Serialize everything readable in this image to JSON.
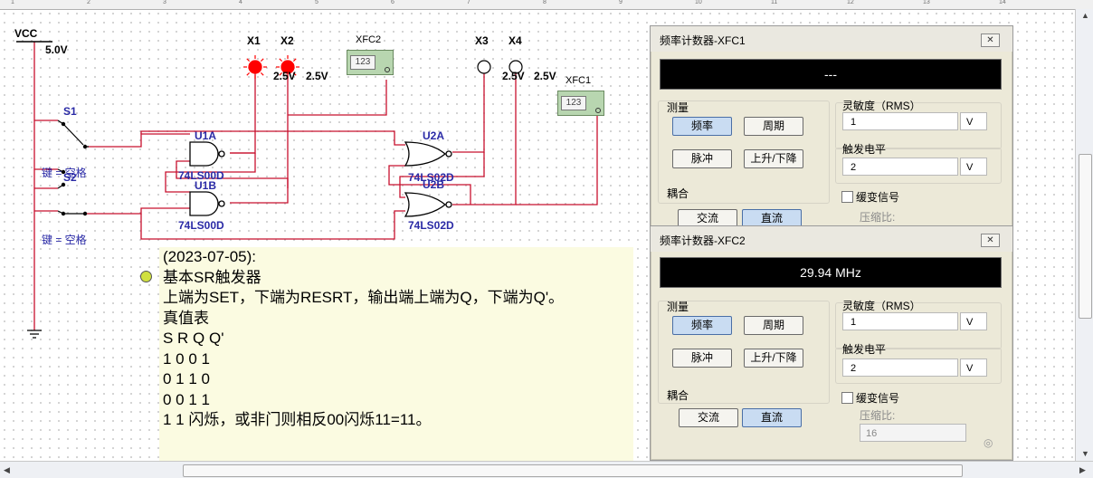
{
  "ruler_ticks": [
    "1",
    "2",
    "3",
    "4",
    "5",
    "6",
    "7",
    "8",
    "9",
    "10",
    "11",
    "12",
    "13",
    "14"
  ],
  "schematic": {
    "vcc_label": "VCC",
    "vcc_voltage": "5.0V",
    "switch1": {
      "name": "S1",
      "key": "键 = 空格"
    },
    "switch2": {
      "name": "S2",
      "key": "键 = 空格"
    },
    "gate_u1a": {
      "name": "U1A",
      "part": "74LS00D"
    },
    "gate_u1b": {
      "name": "U1B",
      "part": "74LS00D"
    },
    "gate_u2a": {
      "name": "U2A",
      "part": "74LS02D"
    },
    "gate_u2b": {
      "name": "U2B",
      "part": "74LS02D"
    },
    "probes": [
      {
        "name": "X1",
        "voltage": "2.5V",
        "lit": true
      },
      {
        "name": "X2",
        "voltage": "2.5V",
        "lit": true
      },
      {
        "name": "X3",
        "voltage": "2.5V",
        "lit": false
      },
      {
        "name": "X4",
        "voltage": "2.5V",
        "lit": false
      }
    ],
    "xfc2_label": "XFC2",
    "xfc1_label": "XFC1",
    "instrument_display": "123",
    "wire_color": "#c8102e",
    "probe_lit_color": "#ff0000"
  },
  "note": {
    "lines": [
      " (2023-07-05):",
      "基本SR触发器",
      "上端为SET，下端为RESRT，输出端上端为Q，下端为Q'。",
      "真值表",
      "S R Q Q'",
      "1 0  0  1",
      "0 1  1  0",
      "0 0  1  1",
      "1 1  闪烁，或非门则相反00闪烁11=11。"
    ]
  },
  "xfc1_window": {
    "title": "频率计数器-XFC1",
    "display": "---",
    "measure_label": "测量",
    "btn_freq": "频率",
    "btn_period": "周期",
    "btn_pulse": "脉冲",
    "btn_rise_fall": "上升/下降",
    "sensitivity_label": "灵敏度（RMS）",
    "sensitivity_value": "1",
    "sensitivity_unit": "V",
    "trigger_label": "触发电平",
    "trigger_value": "2",
    "trigger_unit": "V",
    "coupling_label": "耦合",
    "btn_ac": "交流",
    "btn_dc": "直流",
    "slow_signal_label": "缓变信号",
    "compress_label": "压缩比:"
  },
  "xfc2_window": {
    "title": "频率计数器-XFC2",
    "display": "29.94 MHz",
    "measure_label": "测量",
    "btn_freq": "频率",
    "btn_period": "周期",
    "btn_pulse": "脉冲",
    "btn_rise_fall": "上升/下降",
    "sensitivity_label": "灵敏度（RMS）",
    "sensitivity_value": "1",
    "sensitivity_unit": "V",
    "trigger_label": "触发电平",
    "trigger_value": "2",
    "trigger_unit": "V",
    "coupling_label": "耦合",
    "btn_ac": "交流",
    "btn_dc": "直流",
    "slow_signal_label": "缓变信号",
    "compress_label": "压缩比:",
    "compress_value": "16"
  }
}
